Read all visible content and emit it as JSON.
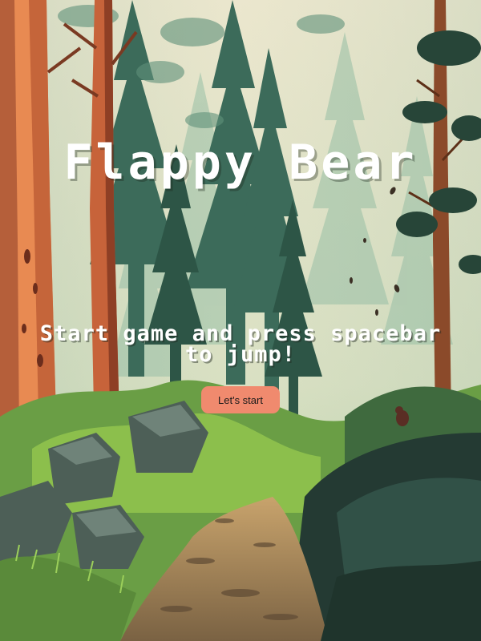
{
  "game": {
    "title": "Flappy Bear",
    "instructions": "Start game and press spacebar to jump!",
    "start_button_label": "Let's start"
  },
  "colors": {
    "button_background": "#f08a6e",
    "text": "#ffffff",
    "sky": "#efe4c8",
    "trunk": "#e0804c",
    "pine": "#2f5a4a",
    "grass": "#7bb043"
  }
}
